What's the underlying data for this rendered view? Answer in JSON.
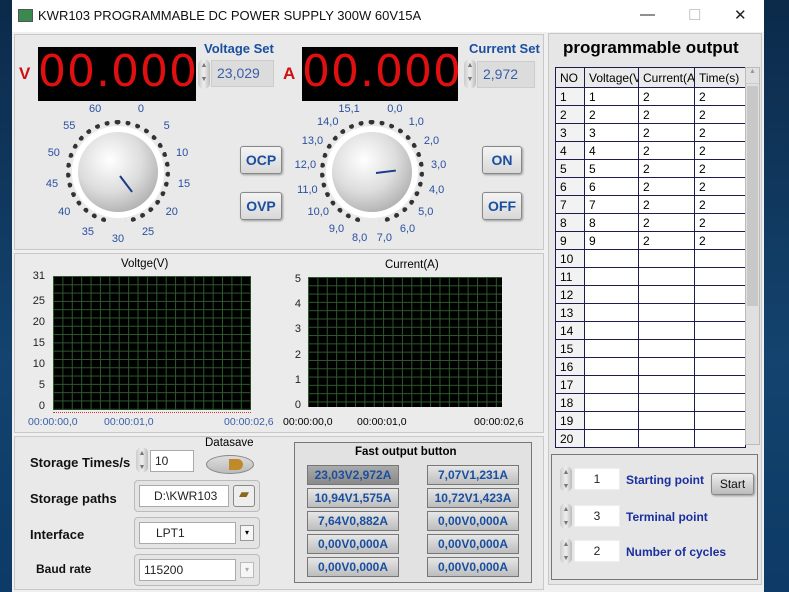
{
  "window": {
    "title": "KWR103 PROGRAMMABLE DC POWER SUPPLY 300W  60V15A",
    "minimize": "—",
    "maximize": "☐",
    "close": "✕"
  },
  "voltage": {
    "unit": "V",
    "display": "00.000",
    "set_label": "Voltage Set",
    "set_value": "23,029",
    "scale": [
      "0",
      "5",
      "10",
      "15",
      "20",
      "25",
      "30",
      "35",
      "40",
      "45",
      "50",
      "55",
      "60"
    ],
    "knob_value": 23.029,
    "knob_max": 60
  },
  "current": {
    "unit": "A",
    "display": "00.000",
    "set_label": "Current Set",
    "set_value": "2,972",
    "scale": [
      "0,0",
      "1,0",
      "2,0",
      "3,0",
      "4,0",
      "5,0",
      "6,0",
      "7,0",
      "8,0",
      "9,0",
      "10,0",
      "11,0",
      "12,0",
      "13,0",
      "14,0",
      "15,1"
    ],
    "knob_value": 2.972,
    "knob_max": 15.1
  },
  "buttons": {
    "ocp": "OCP",
    "ovp": "OVP",
    "on": "ON",
    "off": "OFF"
  },
  "chart_data": [
    {
      "type": "line",
      "title": "Voltge(V)",
      "yticks": [
        "31",
        "25",
        "20",
        "15",
        "10",
        "5",
        "0"
      ],
      "ylim": [
        0,
        31
      ],
      "xticks": [
        "00:00:00,0",
        "00:00:01,0",
        "00:00:02,6"
      ],
      "grid": true,
      "series": []
    },
    {
      "type": "line",
      "title": "Current(A)",
      "yticks": [
        "5",
        "4",
        "3",
        "2",
        "1",
        "0"
      ],
      "ylim": [
        0,
        5
      ],
      "xticks": [
        "00:00:00,0",
        "00:00:01,0",
        "00:00:02,6"
      ],
      "grid": true,
      "series": []
    }
  ],
  "storage": {
    "times_label": "Storage Times/s",
    "times_value": "10",
    "datasave_label": "Datasave",
    "paths_label": "Storage paths",
    "path_value": "D:\\KWR103",
    "interface_label": "Interface",
    "interface_value": "LPT1",
    "baud_label": "Baud rate",
    "baud_value": "115200"
  },
  "fast_output": {
    "title": "Fast output button",
    "buttons": [
      "23,03V2,972A",
      "7,07V1,231A",
      "10,94V1,575A",
      "10,72V1,423A",
      "7,64V0,882A",
      "0,00V0,000A",
      "0,00V0,000A",
      "0,00V0,000A",
      "0,00V0,000A",
      "0,00V0,000A"
    ]
  },
  "program": {
    "title": "programmable output",
    "columns": [
      "NO",
      "Voltage(V",
      "Current(A",
      "Time(s)"
    ],
    "rows": [
      [
        "1",
        "1",
        "2",
        "2"
      ],
      [
        "2",
        "2",
        "2",
        "2"
      ],
      [
        "3",
        "3",
        "2",
        "2"
      ],
      [
        "4",
        "4",
        "2",
        "2"
      ],
      [
        "5",
        "5",
        "2",
        "2"
      ],
      [
        "6",
        "6",
        "2",
        "2"
      ],
      [
        "7",
        "7",
        "2",
        "2"
      ],
      [
        "8",
        "8",
        "2",
        "2"
      ],
      [
        "9",
        "9",
        "2",
        "2"
      ],
      [
        "10",
        "",
        "",
        ""
      ],
      [
        "11",
        "",
        "",
        ""
      ],
      [
        "12",
        "",
        "",
        ""
      ],
      [
        "13",
        "",
        "",
        ""
      ],
      [
        "14",
        "",
        "",
        ""
      ],
      [
        "15",
        "",
        "",
        ""
      ],
      [
        "16",
        "",
        "",
        ""
      ],
      [
        "17",
        "",
        "",
        ""
      ],
      [
        "18",
        "",
        "",
        ""
      ],
      [
        "19",
        "",
        "",
        ""
      ],
      [
        "20",
        "",
        "",
        ""
      ]
    ],
    "starting_point_label": "Starting point",
    "starting_point": "1",
    "terminal_point_label": "Terminal point",
    "terminal_point": "3",
    "cycles_label": "Number of cycles",
    "cycles": "2",
    "start": "Start"
  }
}
